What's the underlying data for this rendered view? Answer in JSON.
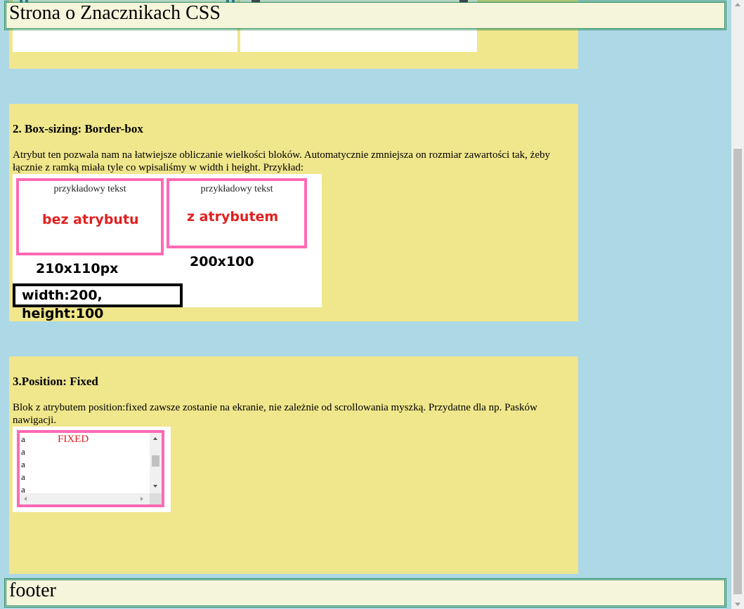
{
  "header": {
    "title": "Strona o Znacznikach CSS"
  },
  "footer": {
    "text": "footer"
  },
  "section_box_sizing": {
    "heading": "2. Box-sizing: Border-box",
    "description": "Atrybut ten pozwala nam na łatwiejsze obliczanie wielkości bloków. Automatycznie zmniejsza on rozmiar zawartości tak, żeby łącznie z ramką miała tyle co wpisaliśmy w width i height. Przykład:",
    "example": {
      "box1_text": "przykładowy tekst",
      "box1_label": "bez atrybutu",
      "box1_size": "210x110px",
      "box2_text": "przykładowy tekst",
      "box2_label": "z atrybutem",
      "box2_size": "200x100",
      "css_caption": "width:200, height:100"
    }
  },
  "section_fixed": {
    "heading": "3.Position: Fixed",
    "description": "Blok z atrybutem position:fixed zawsze zostanie na ekranie, nie zależnie od scrollowania myszką. Przydatne dla np. Pasków nawigacji.",
    "example": {
      "fixed_label": "FIXED",
      "lines": [
        "a",
        "a",
        "a",
        "a",
        "a"
      ]
    }
  },
  "colors": {
    "page_bg": "#add8e6",
    "section_bg": "#f0e68c",
    "header_bg": "#f5f5dc",
    "pink_border": "#ff69b4",
    "red_text": "#e02020"
  }
}
